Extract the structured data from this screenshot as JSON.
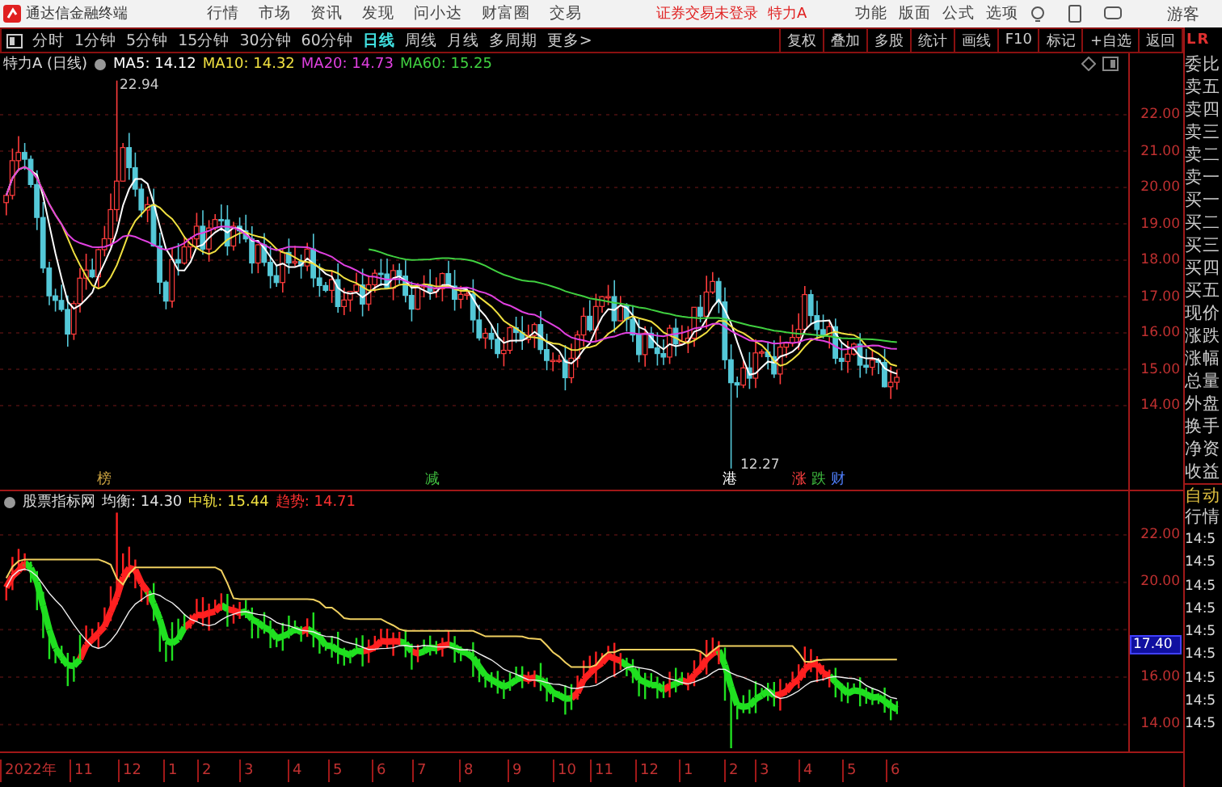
{
  "app": {
    "title": "通达信金融终端",
    "menu": [
      "行情",
      "市场",
      "资讯",
      "发现",
      "问小达",
      "财富圈",
      "交易"
    ],
    "login_status": "证券交易未登录",
    "stock": "特力A",
    "tools": [
      "功能",
      "版面",
      "公式",
      "选项"
    ],
    "user": "游客"
  },
  "periods": [
    {
      "label": "分时",
      "selected": false
    },
    {
      "label": "1分钟",
      "selected": false
    },
    {
      "label": "5分钟",
      "selected": false
    },
    {
      "label": "15分钟",
      "selected": false
    },
    {
      "label": "30分钟",
      "selected": false
    },
    {
      "label": "60分钟",
      "selected": false
    },
    {
      "label": "日线",
      "selected": true
    },
    {
      "label": "周线",
      "selected": false
    },
    {
      "label": "月线",
      "selected": false
    },
    {
      "label": "多周期",
      "selected": false
    },
    {
      "label": "更多>",
      "selected": false
    }
  ],
  "actions": [
    "复权",
    "叠加",
    "多股",
    "统计",
    "画线",
    "F10",
    "标记",
    "+自选",
    "返回"
  ],
  "main_chart": {
    "title": "特力A (日线)",
    "legend": [
      {
        "label": "MA5: 14.12",
        "color": "#ffffff"
      },
      {
        "label": "MA10: 14.32",
        "color": "#f0e040"
      },
      {
        "label": "MA20: 14.73",
        "color": "#e040e0"
      },
      {
        "label": "MA60: 15.25",
        "color": "#40d040"
      }
    ],
    "high_label": "22.94",
    "low_label": "12.27",
    "y_labels": [
      "22.00",
      "21.00",
      "20.00",
      "19.00",
      "18.00",
      "17.00",
      "16.00",
      "15.00",
      "14.00"
    ],
    "markers": [
      {
        "label": "榜",
        "color": "#c8a040"
      },
      {
        "label": "减",
        "color": "#40c040"
      },
      {
        "label": "港",
        "color": "#ffffff"
      },
      {
        "label": "涨",
        "color": "#ff4040"
      },
      {
        "label": "跌",
        "color": "#40c040"
      },
      {
        "label": "财",
        "color": "#5080ff"
      }
    ]
  },
  "indicator": {
    "title": "股票指标网",
    "legend": [
      {
        "label": "均衡: 14.30",
        "color": "#e0e0e0"
      },
      {
        "label": "中轨: 15.44",
        "color": "#f0e040"
      },
      {
        "label": "趋势: 14.71",
        "color": "#ff3030"
      }
    ],
    "y_labels": [
      "22.00",
      "20.00",
      "16.00",
      "14.00"
    ],
    "current": "17.40"
  },
  "x_labels": [
    "2022年",
    "11",
    "12",
    "1",
    "2",
    "3",
    "4",
    "5",
    "6",
    "7",
    "8",
    "9",
    "10",
    "11",
    "12",
    "1",
    "2",
    "3",
    "4",
    "5",
    "6"
  ],
  "side_panel": {
    "header": [
      "L",
      "R"
    ],
    "quote_rows": [
      "委比",
      "卖五",
      "卖四",
      "卖三",
      "卖二",
      "卖一",
      "买一",
      "买二",
      "买三",
      "买四",
      "买五",
      "现价",
      "涨跌",
      "涨幅",
      "总量",
      "外盘",
      "换手",
      "净资",
      "收益"
    ],
    "tab": "自动",
    "section": "行情",
    "times": [
      "14:5",
      "14:5",
      "14:5",
      "14:5",
      "14:5",
      "14:5",
      "14:5",
      "14:5",
      "14:5"
    ]
  }
}
